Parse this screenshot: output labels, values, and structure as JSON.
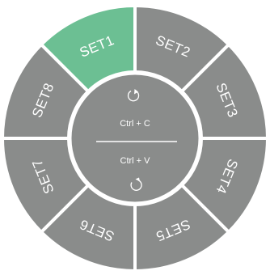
{
  "colors": {
    "segment": "#8a8c8b",
    "segment_active": "#6cbf93",
    "separator": "#ffffff",
    "hub": "#8a8c8b",
    "text": "#ffffff"
  },
  "segments": [
    {
      "label": "SET1",
      "active": true
    },
    {
      "label": "SET2",
      "active": false
    },
    {
      "label": "SET3",
      "active": false
    },
    {
      "label": "SET4",
      "active": false
    },
    {
      "label": "SET5",
      "active": false
    },
    {
      "label": "SET6",
      "active": false
    },
    {
      "label": "SET7",
      "active": false
    },
    {
      "label": "SET8",
      "active": false
    }
  ],
  "hub": {
    "copy_label": "Ctrl + C",
    "paste_label": "Ctrl + V",
    "copy_icon": "rotate-ccw-icon",
    "paste_icon": "rotate-cw-icon"
  }
}
